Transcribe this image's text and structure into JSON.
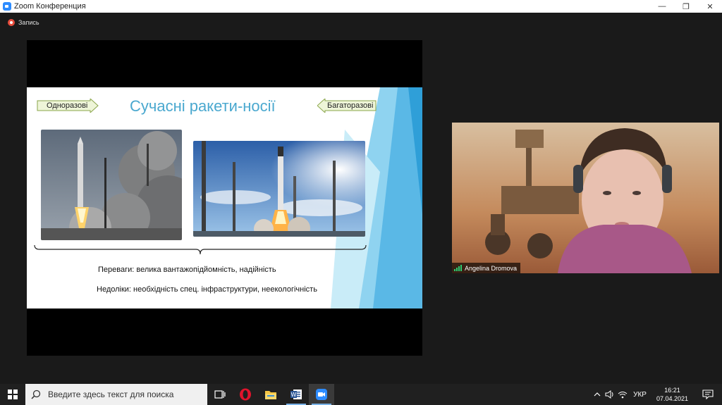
{
  "window": {
    "title": "Zoom Конференция",
    "controls": {
      "minimize": "—",
      "restore": "❐",
      "close": "✕"
    }
  },
  "recording": {
    "label": "Запись"
  },
  "slide": {
    "title": "Сучасні ракети-носії",
    "left_tag": "Одноразові",
    "right_tag": "Багаторазові",
    "advantages": "Переваги: велика вантажопідйомність, надійність",
    "disadvantages": "Недоліки: необхідність спец. інфраструктури, неекологічність"
  },
  "participant": {
    "name": "Angelina Dromova"
  },
  "taskbar": {
    "search_placeholder": "Введите здесь текст для поиска",
    "language": "УКР",
    "time": "16:21",
    "date": "07.04.2021",
    "pinned": [
      "task-view-icon",
      "opera-icon",
      "file-explorer-icon",
      "word-icon",
      "zoom-icon"
    ]
  },
  "colors": {
    "slide_title": "#4aa8cf",
    "accent_blue": "#2d8cff",
    "record_red": "#e74c3c",
    "taskbar_bg": "#202020"
  }
}
